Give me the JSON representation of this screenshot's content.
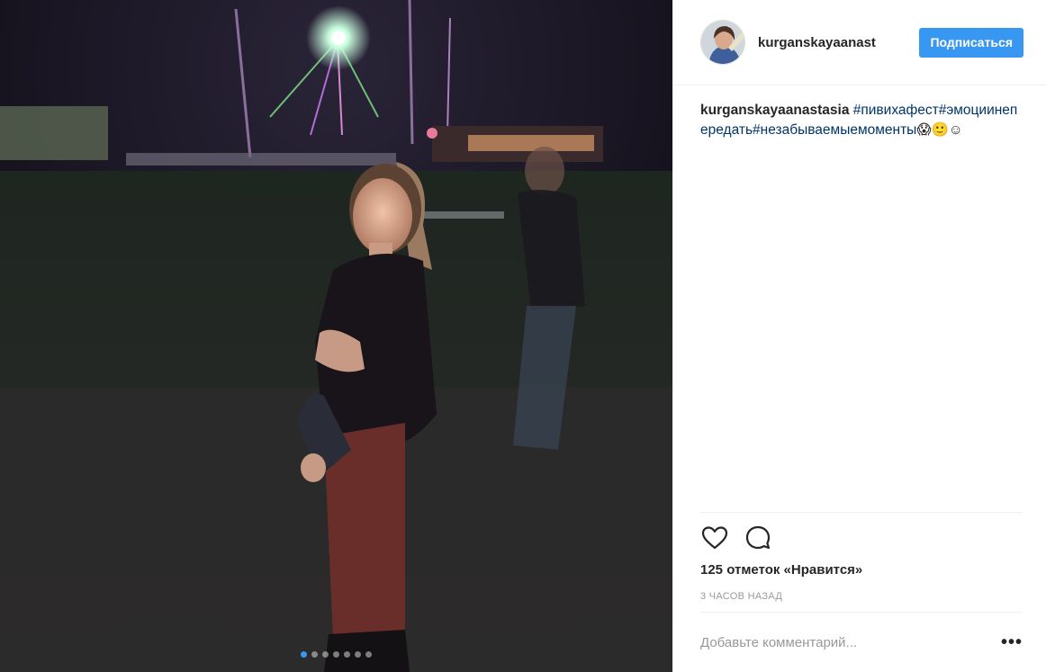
{
  "post": {
    "images_count": 7,
    "active_image_index": 0
  },
  "header": {
    "username": "kurganskayaanast",
    "follow_label": "Подписаться",
    "avatar_icon": "profile-photo"
  },
  "caption": {
    "username": "kurganskayaanastasia",
    "hashtags": [
      "#пивихафест",
      "#эмоции",
      "непередать",
      "#незабываемыемоменты"
    ],
    "emoji": "😱🙂☺"
  },
  "actions": {
    "like_icon": "heart-outline-icon",
    "comment_icon": "speech-bubble-icon"
  },
  "likes": {
    "text": "125 отметок «Нравится»"
  },
  "timestamp": {
    "text": "3 часов назад"
  },
  "comment": {
    "placeholder": "Добавьте комментарий...",
    "more_label": "•••"
  },
  "colors": {
    "accent": "#3897f0",
    "hashtag": "#003569",
    "muted": "#999999",
    "text": "#262626"
  }
}
